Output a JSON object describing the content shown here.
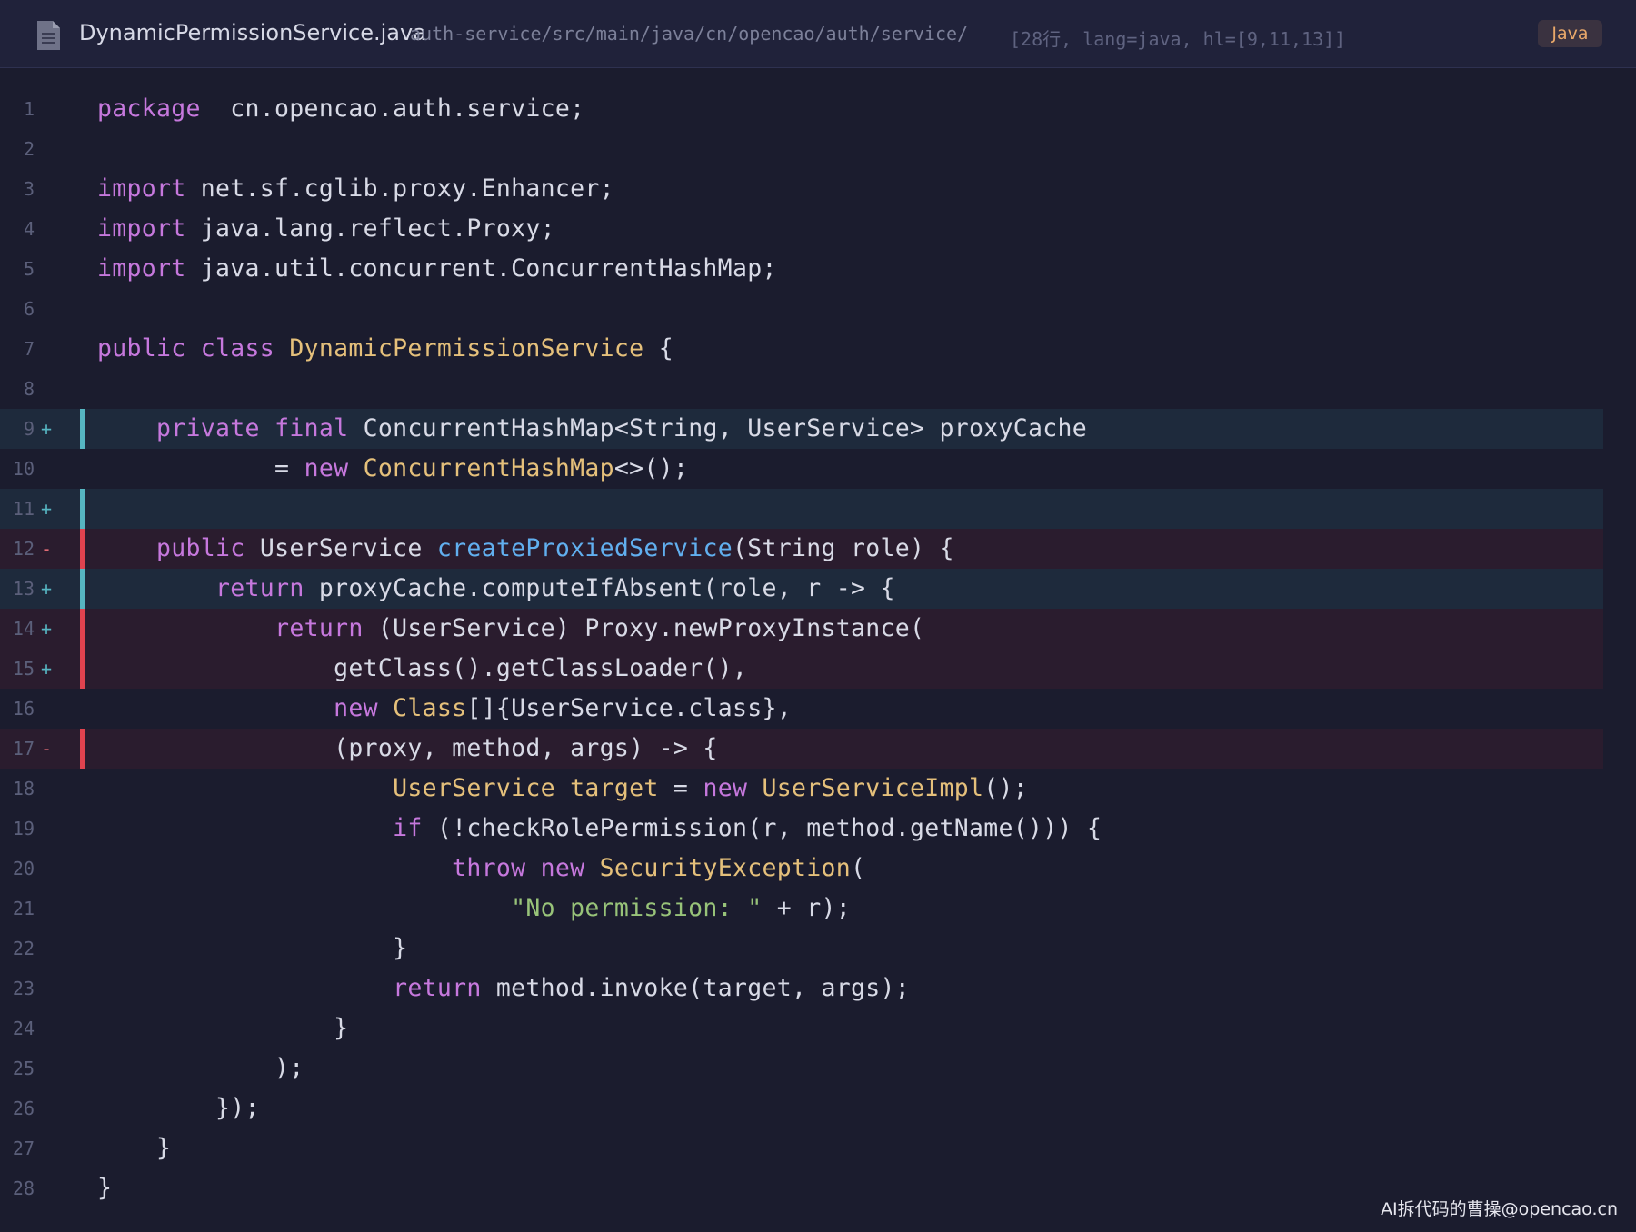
{
  "header": {
    "file_icon": "document-icon",
    "file_name": "DynamicPermissionService.java",
    "file_path": "auth-service/src/main/java/cn/opencao/auth/service/",
    "meta": "[28行, lang=java, hl=[9,11,13]]",
    "language": "Java"
  },
  "colors": {
    "background": "#1b1c2e",
    "added_bar": "#56b6c2",
    "removed_bar": "#e0434f",
    "keyword": "#c678dd",
    "type": "#e5c07b",
    "function": "#61afef",
    "string": "#98c379"
  },
  "code_lines": [
    {
      "num": "1",
      "marker": "",
      "hl": "",
      "tokens": [
        [
          "kw",
          "package"
        ],
        [
          "",
          "  cn.opencao.auth.service;"
        ]
      ]
    },
    {
      "num": "2",
      "marker": "",
      "hl": "",
      "tokens": []
    },
    {
      "num": "3",
      "marker": "",
      "hl": "",
      "tokens": [
        [
          "kw",
          "import"
        ],
        [
          "",
          " net.sf.cglib.proxy.Enhancer;"
        ]
      ]
    },
    {
      "num": "4",
      "marker": "",
      "hl": "",
      "tokens": [
        [
          "kw",
          "import"
        ],
        [
          "",
          " java.lang.reflect.Proxy;"
        ]
      ]
    },
    {
      "num": "5",
      "marker": "",
      "hl": "",
      "tokens": [
        [
          "kw",
          "import"
        ],
        [
          "",
          " java.util.concurrent.ConcurrentHashMap;"
        ]
      ]
    },
    {
      "num": "6",
      "marker": "",
      "hl": "",
      "tokens": []
    },
    {
      "num": "7",
      "marker": "",
      "hl": "",
      "tokens": [
        [
          "kw",
          "public class"
        ],
        [
          "",
          " "
        ],
        [
          "ty",
          "DynamicPermissionService"
        ],
        [
          "",
          " {"
        ]
      ]
    },
    {
      "num": "8",
      "marker": "",
      "hl": "",
      "tokens": []
    },
    {
      "num": "9",
      "marker": "+",
      "hl": "add",
      "tokens": [
        [
          "",
          "    "
        ],
        [
          "kw",
          "private final"
        ],
        [
          "",
          " ConcurrentHashMap<String, UserService> proxyCache"
        ]
      ]
    },
    {
      "num": "10",
      "marker": "",
      "hl": "",
      "tokens": [
        [
          "",
          "            = "
        ],
        [
          "kw",
          "new"
        ],
        [
          "",
          " "
        ],
        [
          "ty",
          "ConcurrentHashMap"
        ],
        [
          "",
          "<>();"
        ]
      ]
    },
    {
      "num": "11",
      "marker": "+",
      "hl": "add",
      "tokens": []
    },
    {
      "num": "12",
      "marker": "-",
      "hl": "del",
      "tokens": [
        [
          "",
          "    "
        ],
        [
          "kw",
          "public"
        ],
        [
          "",
          " UserService "
        ],
        [
          "fn",
          "createProxiedService"
        ],
        [
          "",
          "(String role) {"
        ]
      ]
    },
    {
      "num": "13",
      "marker": "+",
      "hl": "add",
      "tokens": [
        [
          "",
          "        "
        ],
        [
          "kw",
          "return"
        ],
        [
          "",
          " proxyCache.computeIfAbsent(role, r -> {"
        ]
      ]
    },
    {
      "num": "14",
      "marker": "+",
      "hl": "del",
      "tokens": [
        [
          "",
          "            "
        ],
        [
          "kw",
          "return"
        ],
        [
          "",
          " (UserService) Proxy.newProxyInstance("
        ]
      ]
    },
    {
      "num": "15",
      "marker": "+",
      "hl": "del",
      "tokens": [
        [
          "",
          "                getClass().getClassLoader(),"
        ]
      ]
    },
    {
      "num": "16",
      "marker": "",
      "hl": "",
      "tokens": [
        [
          "",
          "                "
        ],
        [
          "kw",
          "new"
        ],
        [
          "",
          " "
        ],
        [
          "ty",
          "Class"
        ],
        [
          "",
          "[]{UserService.class},"
        ]
      ]
    },
    {
      "num": "17",
      "marker": "-",
      "hl": "del",
      "tokens": [
        [
          "",
          "                (proxy, method, args) -> {"
        ]
      ]
    },
    {
      "num": "18",
      "marker": "",
      "hl": "",
      "tokens": [
        [
          "",
          "                    "
        ],
        [
          "ty",
          "UserService target"
        ],
        [
          "",
          " = "
        ],
        [
          "kw",
          "new"
        ],
        [
          "",
          " "
        ],
        [
          "ty",
          "UserServiceImpl"
        ],
        [
          "",
          "();"
        ]
      ]
    },
    {
      "num": "19",
      "marker": "",
      "hl": "",
      "tokens": [
        [
          "",
          "                    "
        ],
        [
          "kw",
          "if"
        ],
        [
          "",
          " (!checkRolePermission(r, method.getName())) {"
        ]
      ]
    },
    {
      "num": "20",
      "marker": "",
      "hl": "",
      "tokens": [
        [
          "",
          "                        "
        ],
        [
          "kw",
          "throw new"
        ],
        [
          "",
          " "
        ],
        [
          "ty",
          "SecurityException"
        ],
        [
          "",
          "("
        ]
      ]
    },
    {
      "num": "21",
      "marker": "",
      "hl": "",
      "tokens": [
        [
          "",
          "                            "
        ],
        [
          "str",
          "\"No permission: \""
        ],
        [
          "",
          " + r);"
        ]
      ]
    },
    {
      "num": "22",
      "marker": "",
      "hl": "",
      "tokens": [
        [
          "",
          "                    }"
        ]
      ]
    },
    {
      "num": "23",
      "marker": "",
      "hl": "",
      "tokens": [
        [
          "",
          "                    "
        ],
        [
          "kw",
          "return"
        ],
        [
          "",
          " method.invoke(target, args);"
        ]
      ]
    },
    {
      "num": "24",
      "marker": "",
      "hl": "",
      "tokens": [
        [
          "",
          "                }"
        ]
      ]
    },
    {
      "num": "25",
      "marker": "",
      "hl": "",
      "tokens": [
        [
          "",
          "            );"
        ]
      ]
    },
    {
      "num": "26",
      "marker": "",
      "hl": "",
      "tokens": [
        [
          "",
          "        });"
        ]
      ]
    },
    {
      "num": "27",
      "marker": "",
      "hl": "",
      "tokens": [
        [
          "",
          "    }"
        ]
      ]
    },
    {
      "num": "28",
      "marker": "",
      "hl": "",
      "tokens": [
        [
          "",
          "}"
        ]
      ]
    }
  ],
  "watermark": "AI拆代码的曹操@opencao.cn"
}
